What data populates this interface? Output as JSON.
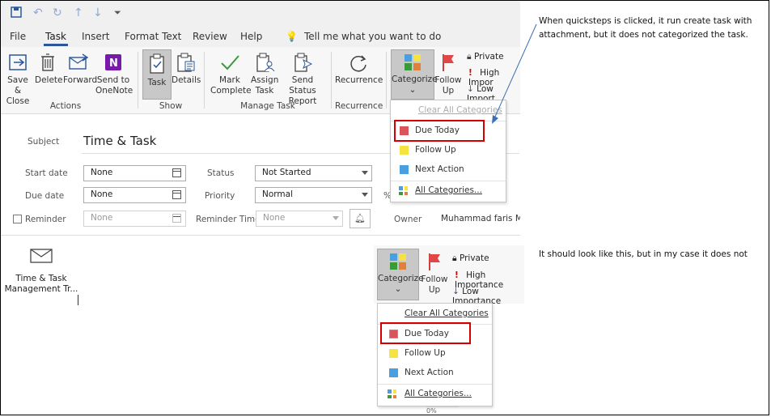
{
  "tabs": [
    "File",
    "Task",
    "Insert",
    "Format Text",
    "Review",
    "Help"
  ],
  "tell_me": "Tell me what you want to do",
  "ribbon": {
    "save_close": "Save & Close",
    "delete": "Delete",
    "forward": "Forward",
    "send_onenote": "Send to OneNote",
    "task": "Task",
    "details": "Details",
    "mark_complete": "Mark Complete",
    "assign_task": "Assign Task",
    "send_status": "Send Status Report",
    "recurrence": "Recurrence",
    "categorize": "Categorize",
    "follow_up": "Follow Up",
    "private": "Private",
    "high_importance_trunc": "High Impor",
    "low_importance_trunc": "Low Import",
    "groups": {
      "actions": "Actions",
      "show": "Show",
      "manage": "Manage Task",
      "recurrence": "Recurrence"
    }
  },
  "form": {
    "subject_label": "Subject",
    "subject_value": "Time & Task",
    "start_label": "Start date",
    "start_value": "None",
    "due_label": "Due date",
    "due_value": "None",
    "reminder_label": "Reminder",
    "reminder_value": "None",
    "status_label": "Status",
    "status_value": "Not Started",
    "priority_label": "Priority",
    "priority_value": "Normal",
    "percent": "%",
    "reminder_time_label": "Reminder Time",
    "reminder_time_value": "None",
    "owner_label": "Owner",
    "owner_value": "Muhammad faris MOI"
  },
  "attachment": {
    "name": "Time & Task Management Tr..."
  },
  "menu": {
    "clear": "Clear All Categories",
    "items": [
      {
        "label": "Due Today",
        "color": "#d9545b"
      },
      {
        "label": "Follow Up",
        "color": "#f5e342"
      },
      {
        "label": "Next Action",
        "color": "#4a9fe0"
      }
    ],
    "all": "All Categories..."
  },
  "ribbon2": {
    "categorize": "Categorize",
    "follow_up": "Follow Up",
    "private": "Private",
    "high": "High Importance",
    "low": "Low Importance",
    "percent_trunc": "0%"
  },
  "annotations": {
    "note1": "When quicksteps is clicked, it run create task with attachment, but it does not categorized the task.",
    "note2": "It should look like this, but in my case it does not"
  }
}
